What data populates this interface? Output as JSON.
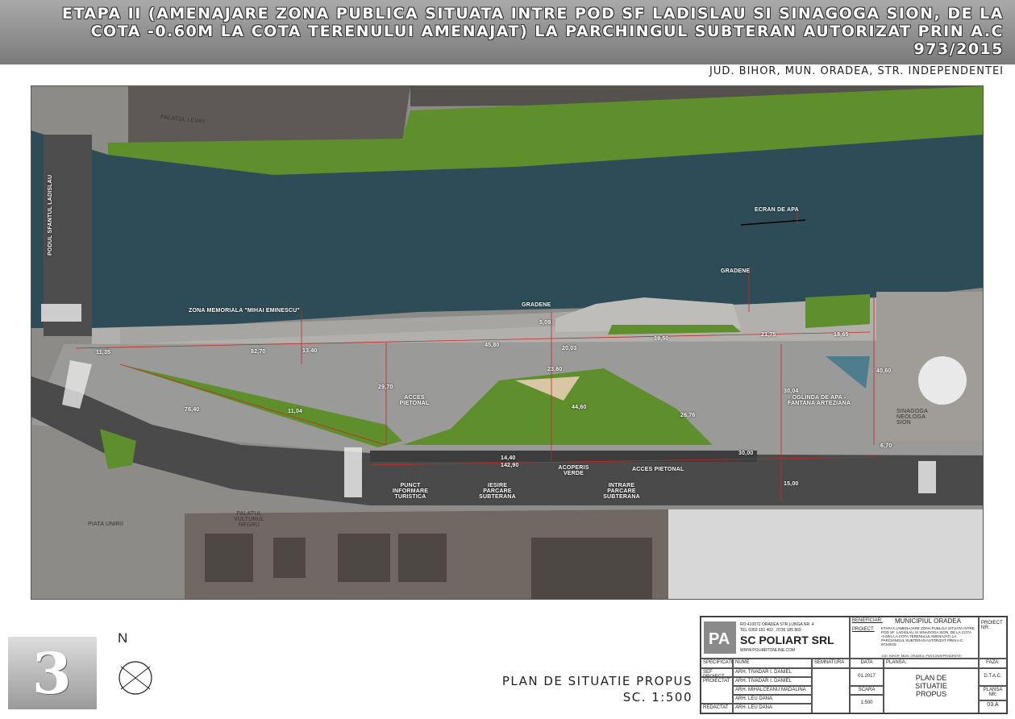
{
  "header": {
    "title": "ETAPA II (AMENAJARE ZONA PUBLICA SITUATA INTRE POD SF LADISLAU SI SINAGOGA SION, DE LA COTA -0.60M LA COTA TERENULUI AMENAJAT) LA PARCHINGUL SUBTERAN AUTORIZAT PRIN A.C 973/2015",
    "location": "JUD. BIHOR, MUN. ORADEA, STR. INDEPENDENTEI"
  },
  "map_labels": {
    "palatul_levay": "PALATUL LEVAY",
    "ecran_de_apa": "ECRAN DE APA",
    "gradene_1": "GRADENE",
    "gradene_2": "GRADENE",
    "podul": "PODUL SFANTUL LADISLAU",
    "zona_memoriala": "ZONA MEMORIALA \"MIHAI EMINESCU\"",
    "acces_pietonal_1": "ACCES PIETONAL",
    "acces_pietonal_2": "ACCES PIETONAL",
    "oglinda": "OGLINDA DE APA - FANTANA ARTEZIANA",
    "sinagoga": "SINAGOGA NEOLOGA SION",
    "punct_info": "PUNCT INFORMARE TURISTICA",
    "iesire_parcare": "IESIRE PARCARE SUBTERANA",
    "acoperis_verde": "ACOPERIS VERDE",
    "intrare_parcare": "INTRARE PARCARE SUBTERANA",
    "piata_unirii": "PIATA UNIRII",
    "palatul_vulturul": "PALATUL VULTURUL NEGRU"
  },
  "dimensions": [
    "11,35",
    "82,70",
    "45,80",
    "39,50",
    "21,75",
    "18,65",
    "76,40",
    "23,60",
    "14,40",
    "142,90",
    "30,00",
    "6,70",
    "40,60",
    "30,04",
    "15,00",
    "29,70",
    "26,76",
    "44,60",
    "13,40",
    "20,03",
    "11,04",
    "5,09"
  ],
  "footer": {
    "sheet_number": "3",
    "north": "N",
    "plan_title": "PLAN DE SITUATIE PROPUS",
    "scale": "SC. 1:500"
  },
  "title_block": {
    "address": "RO 410072 ORADEA STR.LUNGA NR. 4",
    "phone": "TEL 0359 191 402 , 0736 185 869",
    "company": "SC POLIART SRL",
    "web": "WWW.POLIARTONLINE.COM",
    "beneficiar_label": "BENEFICIAR:",
    "beneficiar": "MUNICIPIUL ORADEA",
    "proiect_label": "PROIECT:",
    "proiect": "ETAPA II (AMENAJARE ZONA PUBLICA SITUATA INTRE POD SF. LADISLAU SI SINAGOGA SION, DE LA COTA -0.60m LA COTA TERENULUI AMENAJAT) LA PARCHINGUL SUBTERAN AUTORIZAT PRIN A.C. 973/2015",
    "proiect_loc": "JUD. BIHOR, MUN. ORADEA, PIATA INDEPENDENTEI",
    "proiect_nr_label": "PROIECT NR:",
    "h_specificatie": "SPECIFICATIE",
    "h_nume": "NUME",
    "h_semnatura": "SEMNATURA",
    "h_data": "DATA",
    "h_plansa": "PLANSA:",
    "h_faza": "FAZA:",
    "sef_proiect": "SEF PROIECT",
    "proiectat": "PROIECTAT",
    "redactat": "REDACTAT",
    "n1": "ARH. TIVADAR I. DANIEL",
    "n2": "ARH. TIVADAR I. DANIEL",
    "n3": "ARH. MIHALCEANU MADALINA",
    "n4": "ARH. LEU DANA",
    "n5": "ARH. LEU DANA",
    "data": "01.2017",
    "scara_label": "SCARA",
    "scara": "1:500",
    "plansa": "PLAN DE SITUATIE PROPUS",
    "faza": "D.T.A.C.",
    "plansa_nr_label": "PLANSA NR:",
    "plansa_nr": "03.A"
  },
  "colors": {
    "water": "#2d4c57",
    "grass": "#5f8f2c",
    "road": "#4a4a4a",
    "paving": "#9a9a98",
    "roof": "#6e6763",
    "dim": "#c62828"
  }
}
